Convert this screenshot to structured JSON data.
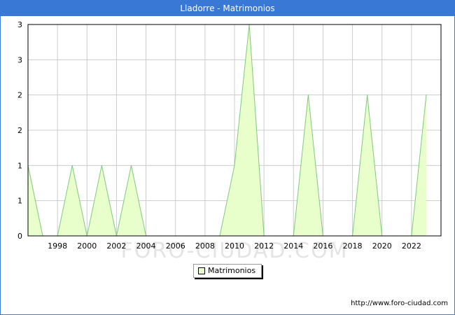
{
  "window": {
    "title": "Lladorre - Matrimonios"
  },
  "watermark": "FORO-CIUDAD.COM",
  "source": "http://www.foro-ciudad.com",
  "colors": {
    "title_bar": "#3a78d6",
    "line": "#80c880",
    "fill": "#e8ffcc",
    "grid": "#cccccc"
  },
  "chart_data": {
    "type": "area",
    "title": "Lladorre - Matrimonios",
    "series": [
      {
        "name": "Matrimonios",
        "x": [
          1996,
          1997,
          1998,
          1999,
          2000,
          2001,
          2002,
          2003,
          2004,
          2005,
          2006,
          2007,
          2008,
          2009,
          2010,
          2011,
          2012,
          2013,
          2014,
          2015,
          2016,
          2017,
          2018,
          2019,
          2020,
          2021,
          2022,
          2023
        ],
        "values": [
          1,
          0,
          0,
          1,
          0,
          1,
          0,
          1,
          0,
          0,
          0,
          0,
          0,
          0,
          1,
          3,
          0,
          0,
          0,
          2,
          0,
          0,
          0,
          2,
          0,
          0,
          0,
          2
        ]
      }
    ],
    "x_ticks": [
      1998,
      2000,
      2002,
      2004,
      2006,
      2008,
      2010,
      2012,
      2014,
      2016,
      2018,
      2020,
      2022
    ],
    "y_ticks": [
      {
        "value": 0,
        "label": "0"
      },
      {
        "value": 0.5,
        "label": "1"
      },
      {
        "value": 1,
        "label": "1"
      },
      {
        "value": 1.5,
        "label": "2"
      },
      {
        "value": 2,
        "label": "2"
      },
      {
        "value": 2.5,
        "label": "3"
      },
      {
        "value": 3,
        "label": "3"
      }
    ],
    "xlim": [
      1996,
      2024
    ],
    "ylim": [
      0,
      3
    ],
    "grid": true,
    "legend_position": "bottom-center"
  }
}
